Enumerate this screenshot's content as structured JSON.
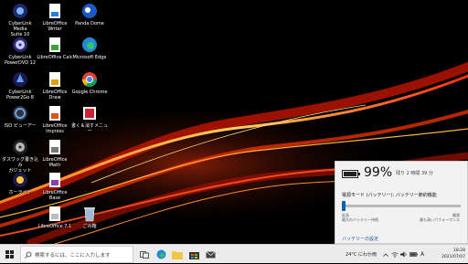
{
  "desktop": {
    "icons": [
      {
        "label": "CyberLink Media\nSuite 10",
        "icon": "cyberlink-media-suite-icon"
      },
      {
        "label": "LibreOffice Writer",
        "icon": "libreoffice-writer-icon"
      },
      {
        "label": "Panda Dome",
        "icon": "panda-dome-icon"
      },
      {
        "label": "CyberLink\nPowerDVD 12",
        "icon": "cyberlink-powerdvd-icon"
      },
      {
        "label": "LibreOffice Calc",
        "icon": "libreoffice-calc-icon"
      },
      {
        "label": "Microsoft Edge",
        "icon": "microsoft-edge-icon"
      },
      {
        "label": "CyberLink\nPower2Go 8",
        "icon": "cyberlink-power2go-icon"
      },
      {
        "label": "LibreOffice Draw",
        "icon": "libreoffice-draw-icon"
      },
      {
        "label": "Google Chrome",
        "icon": "google-chrome-icon"
      },
      {
        "label": "ISO ビューアー",
        "icon": "iso-viewer-icon"
      },
      {
        "label": "LibreOffice Impress",
        "icon": "libreoffice-impress-icon"
      },
      {
        "label": "書く＆消すメニュー",
        "icon": "write-erase-menu-icon"
      },
      {
        "label": "ダスワッグ書き込み\nガジェット",
        "icon": "write-gadget-icon"
      },
      {
        "label": "LibreOffice Math",
        "icon": "libreoffice-math-icon"
      },
      {
        "label": "ホーライテ",
        "icon": "burner-tool-icon"
      },
      {
        "label": "LibreOffice Base",
        "icon": "libreoffice-base-icon"
      },
      {
        "label": "LibreOffice 7.1",
        "icon": "libreoffice-icon"
      },
      {
        "label": "ごみ箱",
        "icon": "recycle-bin-icon"
      }
    ]
  },
  "battery_flyout": {
    "percent_text": "99%",
    "level_fraction": 0.99,
    "remaining": "残り 2 時間 39 分",
    "mode_label": "電源モード (バッテリー): バッテリー節約機能",
    "slider_left": "延長\n最大のバッテリー持続",
    "slider_right": "最適\n最も高いパフォーマンス",
    "slider_position": 0.0,
    "settings_link": "バッテリーの設定"
  },
  "taskbar": {
    "search_placeholder": "検索するには、ここに入力します",
    "weather": "24°C にわか雨",
    "ime": "A",
    "time": "18:28",
    "date": "2021/07/07"
  },
  "colors": {
    "accent": "#0063b1",
    "taskbar_bg": "#ececec",
    "flyout_bg": "#f2f2f2"
  }
}
